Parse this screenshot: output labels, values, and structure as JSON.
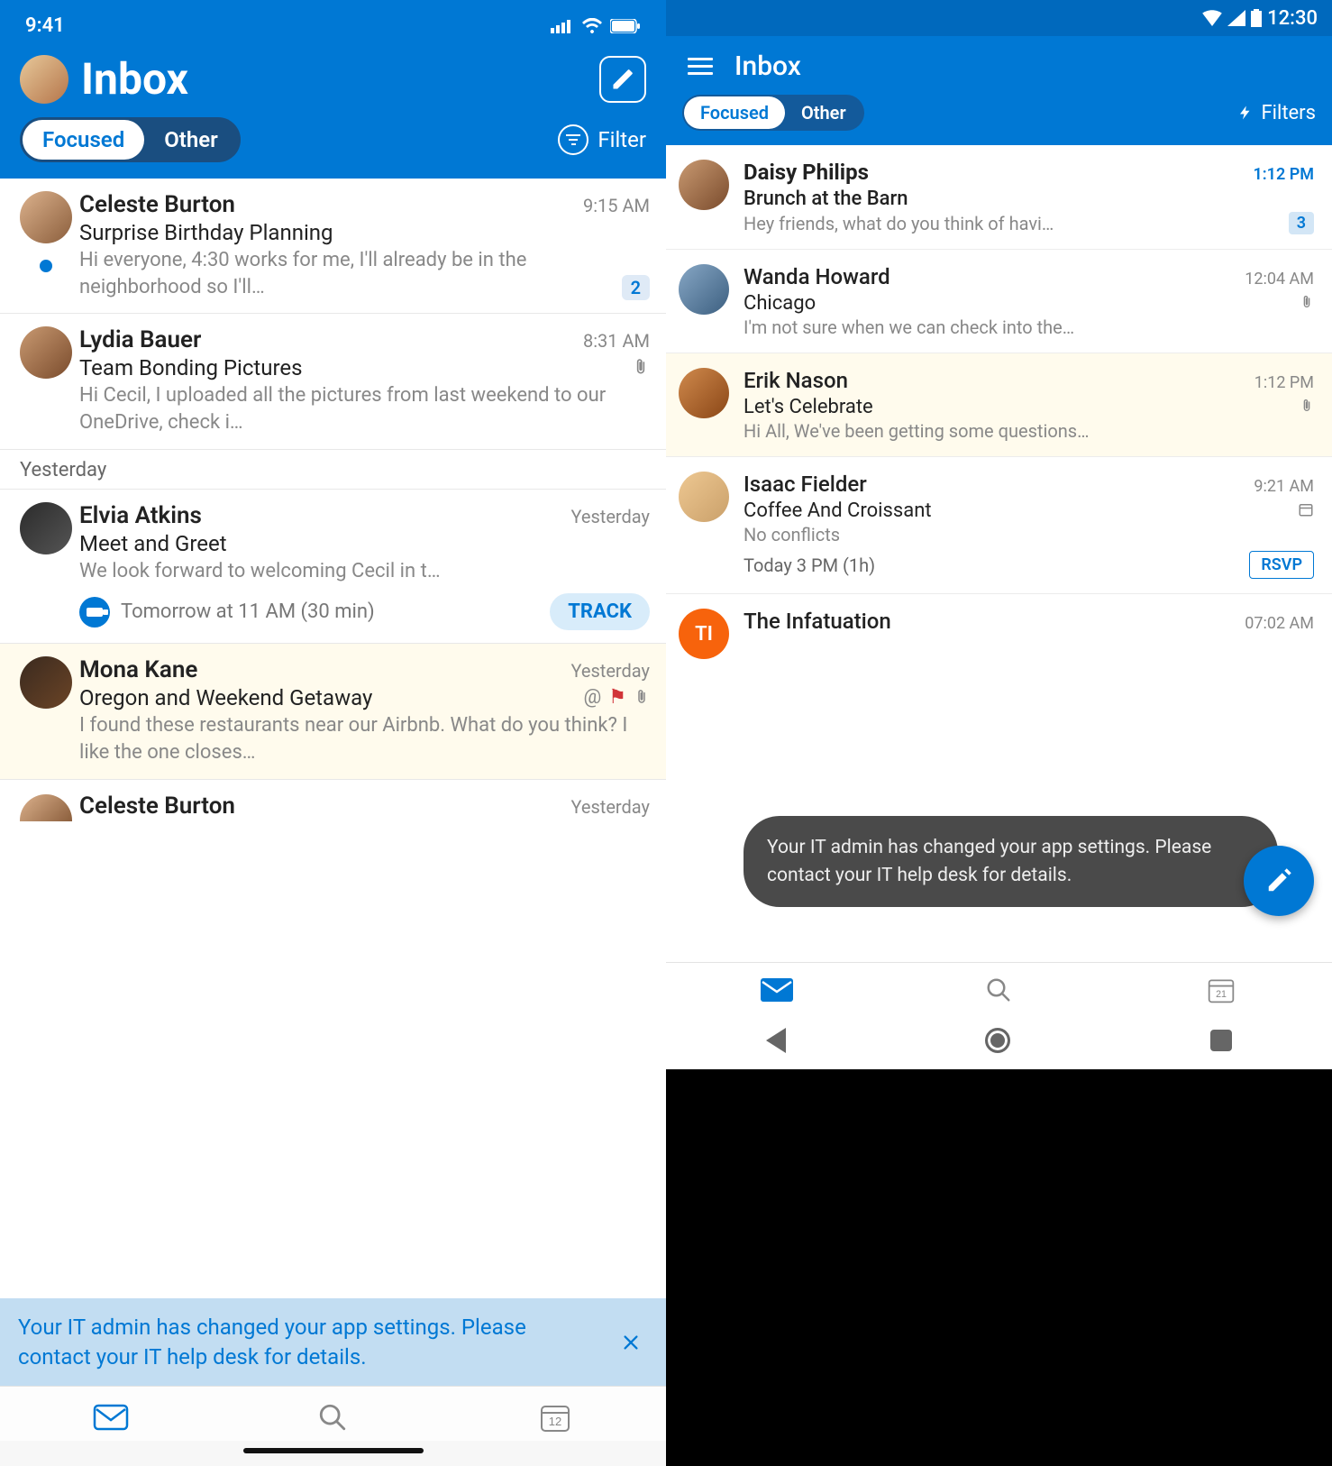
{
  "ios": {
    "status_time": "9:41",
    "title": "Inbox",
    "seg_focused": "Focused",
    "seg_other": "Other",
    "filter_label": "Filter",
    "section_yesterday": "Yesterday",
    "banner_text": "Your IT admin has changed your app settings. Please contact your IT help desk for details.",
    "calendar_day": "12",
    "messages": [
      {
        "sender": "Celeste Burton",
        "time": "9:15 AM",
        "subject": "Surprise Birthday Planning",
        "preview": "Hi everyone, 4:30 works for me, I'll already be in the neighborhood so I'll…",
        "unread": true,
        "badge": "2"
      },
      {
        "sender": "Lydia Bauer",
        "time": "8:31 AM",
        "subject": "Team Bonding Pictures",
        "preview": "Hi Cecil, I uploaded all the pictures from last weekend to our OneDrive, check i…",
        "attachment": true
      },
      {
        "sender": "Elvia Atkins",
        "time": "Yesterday",
        "subject": "Meet and Greet",
        "preview": "We look forward to welcoming Cecil in t…",
        "event_text": "Tomorrow at 11 AM (30 min)",
        "track_label": "TRACK"
      },
      {
        "sender": "Mona Kane",
        "time": "Yesterday",
        "subject": "Oregon and Weekend Getaway",
        "preview": "I found these restaurants near our Airbnb. What do you think? I like the one closes…",
        "mention": true,
        "flag": true,
        "attachment": true,
        "highlight": true
      },
      {
        "sender": "Celeste Burton",
        "time": "Yesterday"
      }
    ]
  },
  "android": {
    "status_time": "12:30",
    "title": "Inbox",
    "seg_focused": "Focused",
    "seg_other": "Other",
    "filters_label": "Filters",
    "toast_text": "Your IT admin has changed your app settings. Please contact your IT help desk for details.",
    "calendar_day": "21",
    "rsvp_label": "RSVP",
    "messages": [
      {
        "sender": "Daisy Philips",
        "time": "1:12 PM",
        "subject": "Brunch at the Barn",
        "preview": "Hey friends, what do you think of havi…",
        "badge": "3",
        "unread": true
      },
      {
        "sender": "Wanda Howard",
        "time": "12:04 AM",
        "subject": "Chicago",
        "preview": "I'm not sure when we can check into the…",
        "attachment": true
      },
      {
        "sender": "Erik Nason",
        "time": "1:12 PM",
        "subject": "Let's Celebrate",
        "preview": "Hi All, We've been getting some questions…",
        "attachment": true,
        "highlight": true
      },
      {
        "sender": "Isaac Fielder",
        "time": "9:21 AM",
        "subject": "Coffee And Croissant",
        "no_conflicts": "No conflicts",
        "calendar": true,
        "event_row": "Today 3 PM (1h)"
      },
      {
        "sender": "The Infatuation",
        "time": "07:02 AM",
        "avatar_initials": "TI"
      }
    ]
  }
}
